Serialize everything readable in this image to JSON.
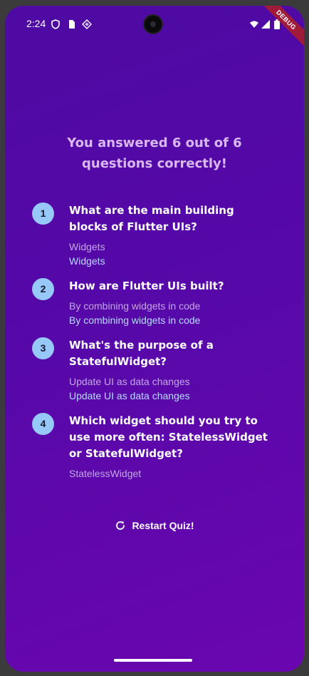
{
  "status_bar": {
    "time": "2:24",
    "left_icons": [
      "vpn-shield-icon",
      "sim-card-icon",
      "data-saver-icon"
    ],
    "right_icons": [
      "wifi-icon",
      "signal-icon",
      "battery-icon"
    ]
  },
  "debug_banner": "DEBUG",
  "result": {
    "title": "You answered 6 out of 6 questions correctly!"
  },
  "summary": [
    {
      "index": "1",
      "question": "What are the main building blocks of Flutter UIs?",
      "user_answer": "Widgets",
      "correct_answer": "Widgets"
    },
    {
      "index": "2",
      "question": "How are Flutter UIs built?",
      "user_answer": "By combining widgets in code",
      "correct_answer": "By combining widgets in code"
    },
    {
      "index": "3",
      "question": "What's the purpose of a StatefulWidget?",
      "user_answer": "Update UI as data changes",
      "correct_answer": "Update UI as data changes"
    },
    {
      "index": "4",
      "question": "Which widget should you try to use more often: StatelessWidget or StatefulWidget?",
      "user_answer": "StatelessWidget"
    }
  ],
  "restart": {
    "label": "Restart Quiz!",
    "icon": "refresh-icon"
  },
  "colors": {
    "background_start": "#4e0aa3",
    "background_end": "#6a06b0",
    "index_circle": "#96c8f8",
    "title_text": "#d9b8f0",
    "user_answer": "#c3a6e6",
    "correct_answer": "#b6dcfc"
  }
}
